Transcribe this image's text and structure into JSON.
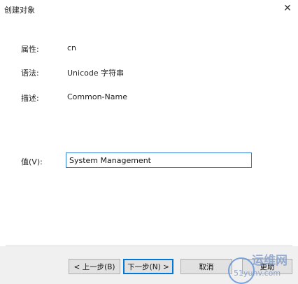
{
  "window": {
    "title": "创建对象",
    "close_glyph": "✕"
  },
  "fields": [
    {
      "label": "属性:",
      "value": "cn"
    },
    {
      "label": "语法:",
      "value": "Unicode 字符串"
    },
    {
      "label": "描述:",
      "value": "Common-Name"
    }
  ],
  "value_field": {
    "label": "值(V):",
    "value": "System Management"
  },
  "buttons": {
    "back": "< 上一步(B)",
    "next": "下一步(N) >",
    "cancel": "取消",
    "more": "更助"
  },
  "watermark": {
    "top": "运维网",
    "bottom": "51yunv.com"
  }
}
